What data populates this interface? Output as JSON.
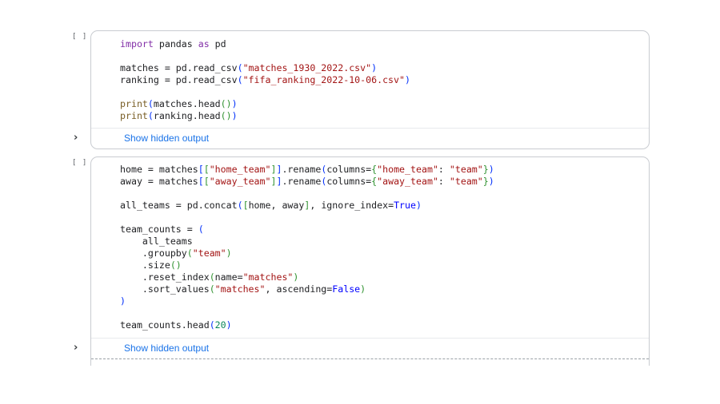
{
  "cells": [
    {
      "run_marker": "[ ]",
      "code": {
        "l1_import": "import",
        "l1_mod": " pandas ",
        "l1_as": "as",
        "l1_alias": " pd",
        "l3_a": "matches = pd.read_csv",
        "l3_str": "\"matches_1930_2022.csv\"",
        "l4_a": "ranking = pd.read_csv",
        "l4_str": "\"fifa_ranking_2022-10-06.csv\"",
        "l6_fn": "print",
        "l6_mid": "matches.head",
        "l7_fn": "print",
        "l7_mid": "ranking.head"
      },
      "output_label": "Show hidden output"
    },
    {
      "run_marker": "[ ]",
      "code": {
        "l1_a": "home = matches",
        "l1_str1": "\"home_team\"",
        "l1_b": ".rename",
        "l1_c": "columns=",
        "l1_str2": "\"home_team\"",
        "l1_d": ": ",
        "l1_str3": "\"team\"",
        "l2_a": "away = matches",
        "l2_str1": "\"away_team\"",
        "l2_b": ".rename",
        "l2_c": "columns=",
        "l2_str2": "\"away_team\"",
        "l2_d": ": ",
        "l2_str3": "\"team\"",
        "l4_a": "all_teams = pd.concat",
        "l4_b": "home, away",
        "l4_c": ", ignore_index=",
        "l4_bool": "True",
        "l6_a": "team_counts = ",
        "l7": "    all_teams",
        "l8_a": "    .groupby",
        "l8_str": "\"team\"",
        "l9_a": "    .size",
        "l10_a": "    .reset_index",
        "l10_b": "name=",
        "l10_str": "\"matches\"",
        "l11_a": "    .sort_values",
        "l11_str": "\"matches\"",
        "l11_b": ", ascending=",
        "l11_bool": "False",
        "l14_a": "team_counts.head",
        "l14_num": "20"
      },
      "output_label": "Show hidden output"
    }
  ],
  "icons": {
    "expand": "chevron-right-icon"
  },
  "colors": {
    "link": "#1a73e8",
    "keyword": "#8330a8",
    "string": "#a31515",
    "boolean": "#0000ff",
    "number": "#098658"
  }
}
